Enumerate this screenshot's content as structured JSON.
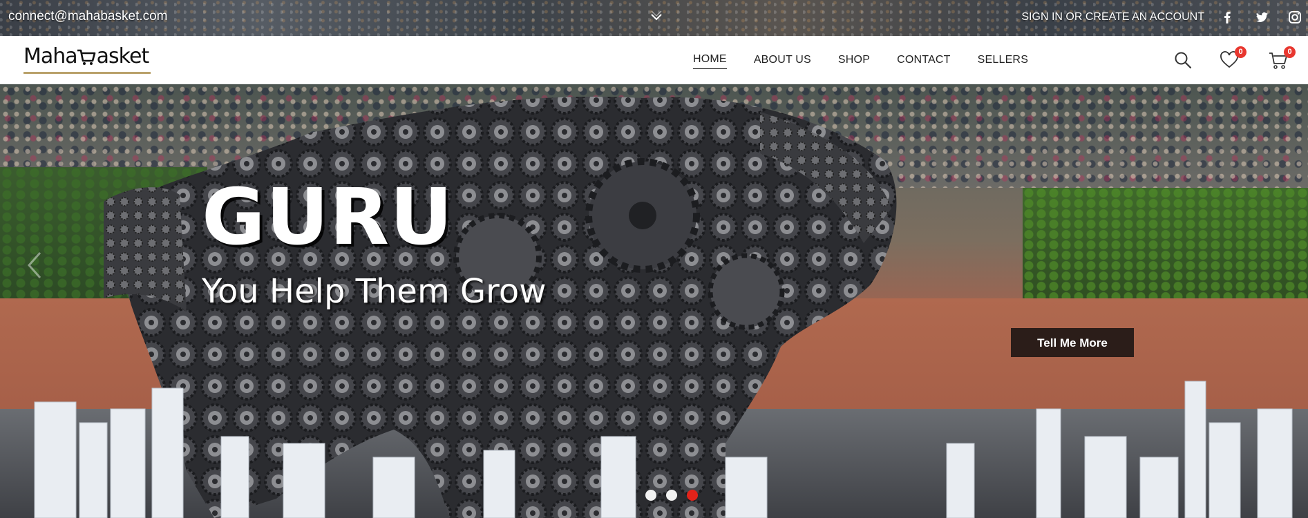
{
  "topbar": {
    "email": "connect@mahabasket.com",
    "account_link": "SIGN IN OR CREATE AN ACCOUNT",
    "social": [
      "facebook-icon",
      "twitter-icon",
      "instagram-icon"
    ]
  },
  "header": {
    "logo_left": "Maha",
    "logo_right": "asket",
    "nav": [
      {
        "label": "HOME",
        "active": true
      },
      {
        "label": "ABOUT US",
        "active": false
      },
      {
        "label": "SHOP",
        "active": false
      },
      {
        "label": "CONTACT",
        "active": false
      },
      {
        "label": "SELLERS",
        "active": false
      }
    ],
    "wishlist_count": "0",
    "cart_count": "0",
    "icons": [
      "search-icon",
      "heart-icon",
      "cart-icon"
    ]
  },
  "hero": {
    "title": "GURU",
    "subtitle": "You Help Them Grow",
    "cta_label": "Tell Me More",
    "slides": 3,
    "active_slide": 3
  },
  "colors": {
    "accent_badge": "#e8372f",
    "cta_bg": "#2b1d19",
    "logo_underline": "#b9a16a",
    "active_dot": "#e2231a"
  }
}
